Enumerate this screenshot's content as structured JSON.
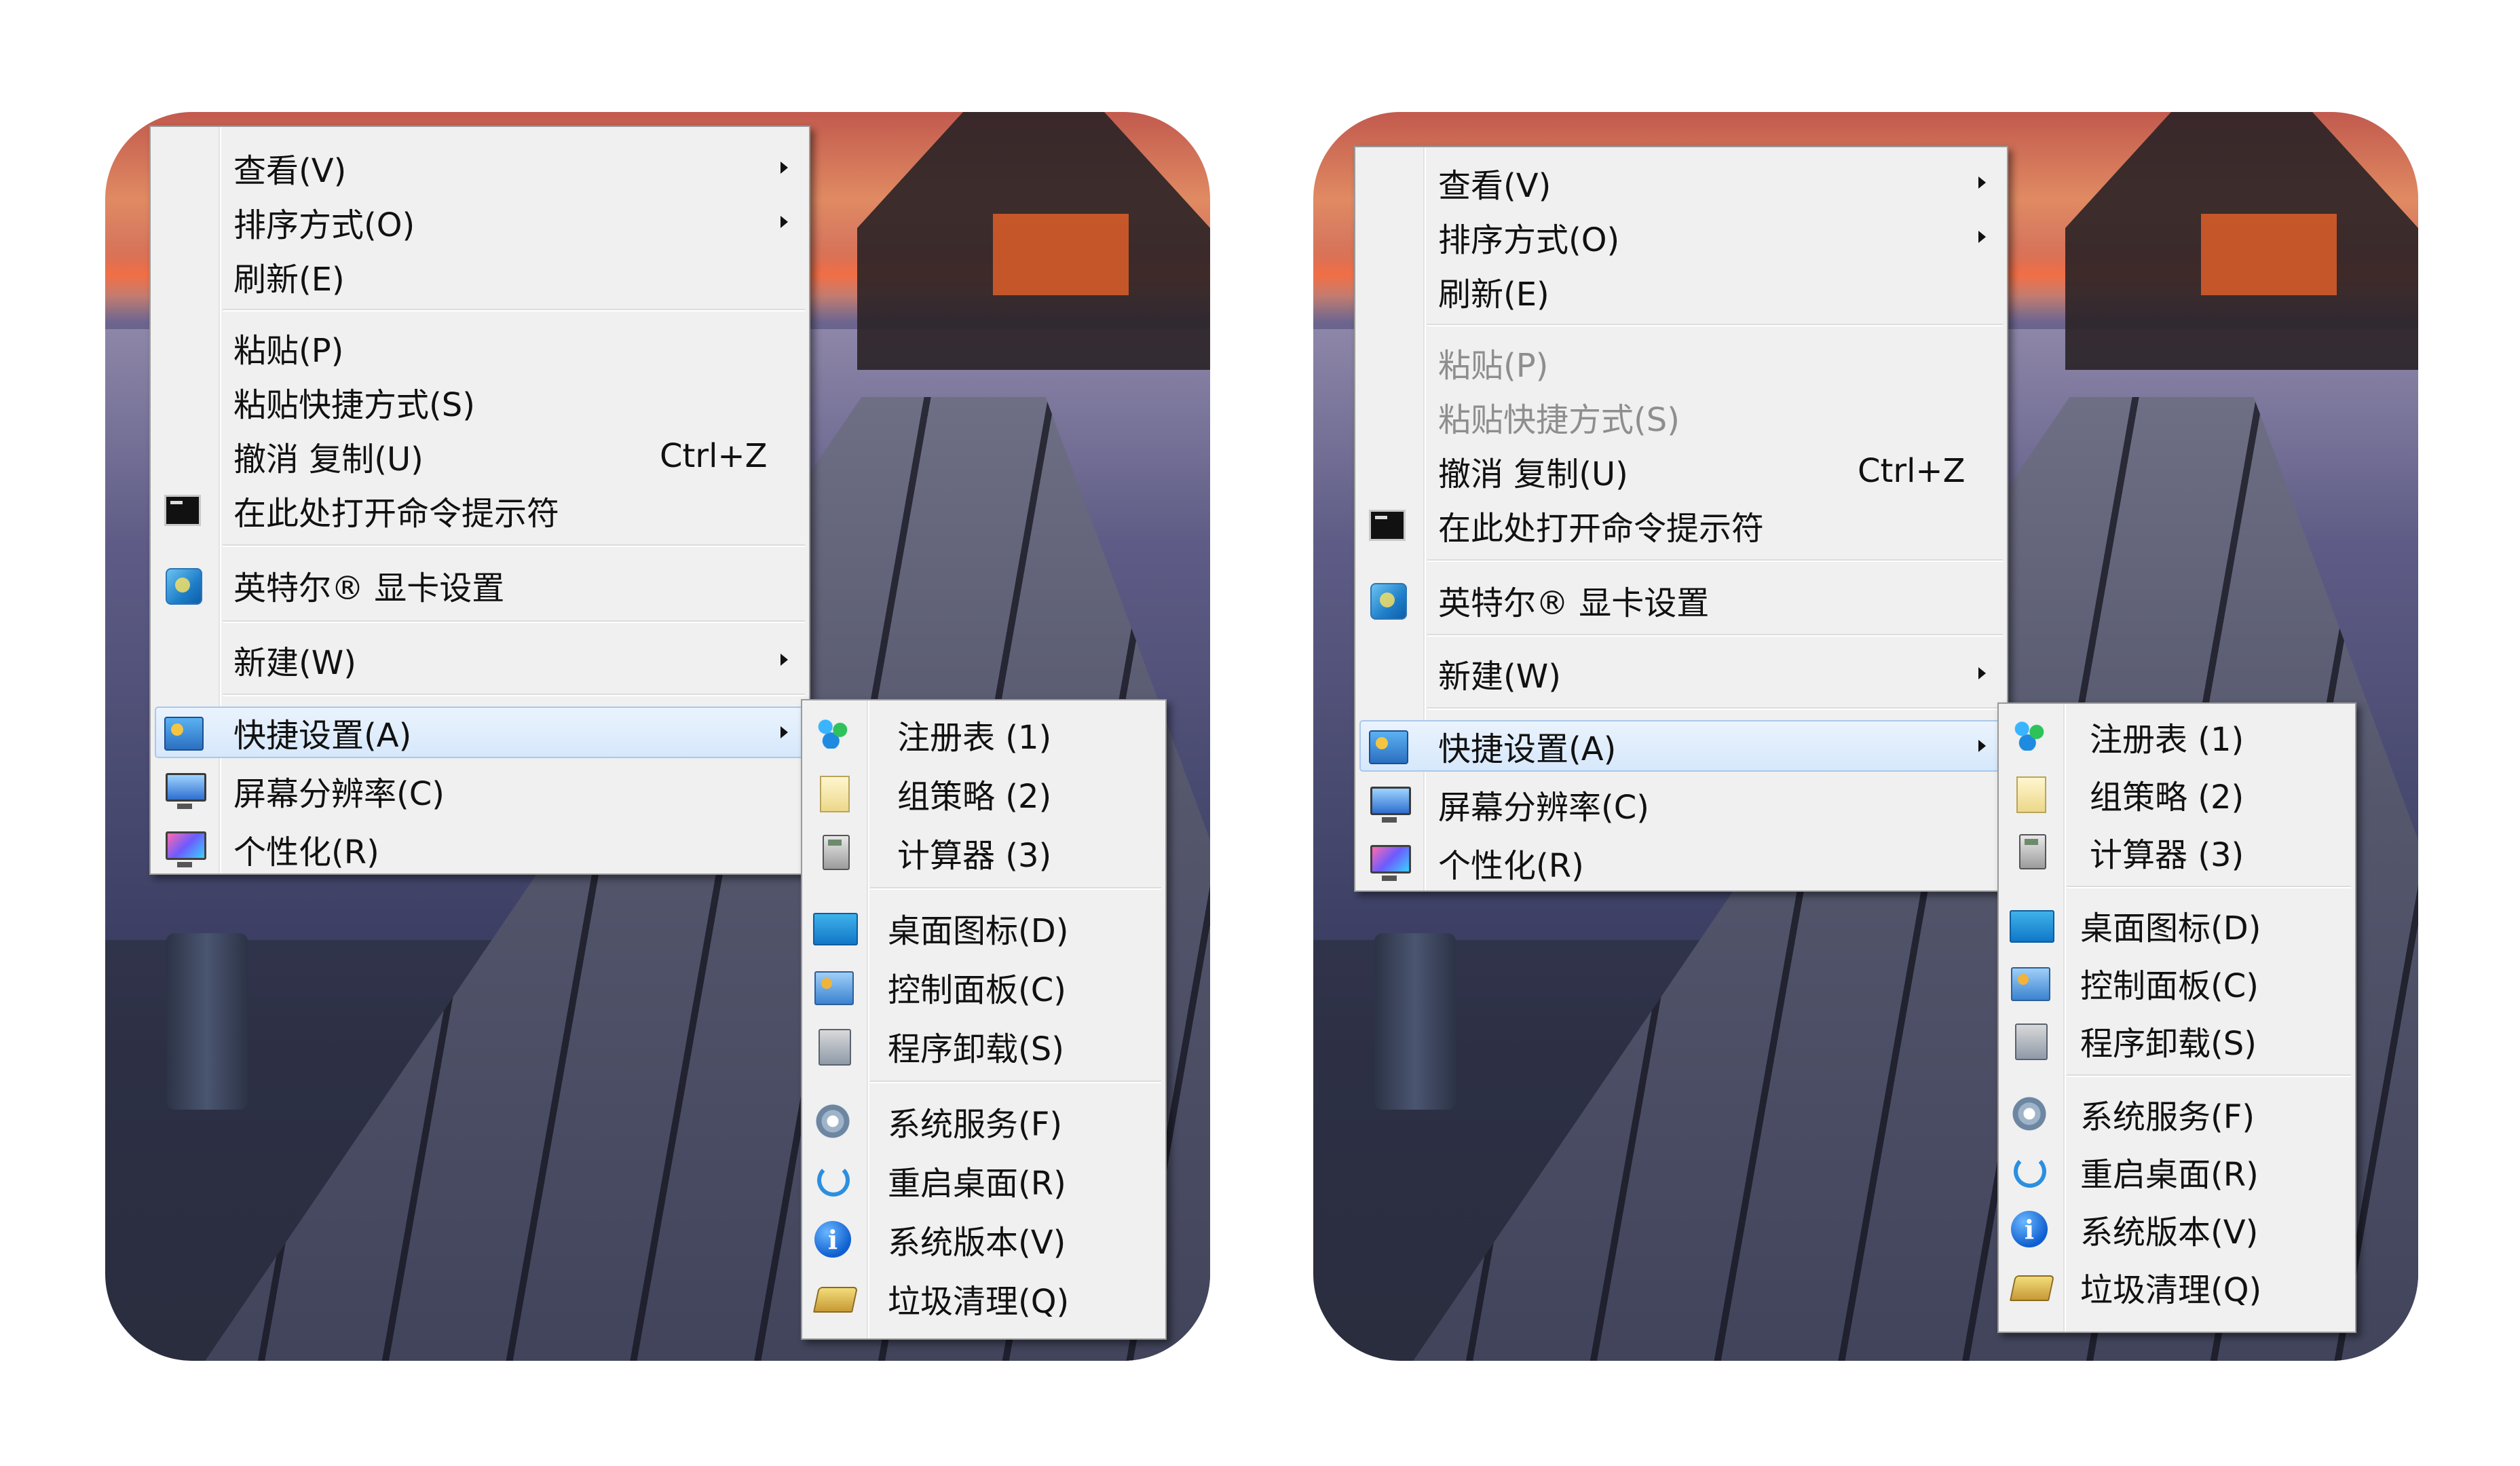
{
  "panels": [
    {
      "variant": "normal",
      "context_menu": {
        "items": [
          {
            "label": "查看(V)",
            "submenu": true
          },
          {
            "label": "排序方式(O)",
            "submenu": true
          },
          {
            "label": "刷新(E)"
          },
          {
            "label": "粘贴(P)"
          },
          {
            "label": "粘贴快捷方式(S)"
          },
          {
            "label": "撤消 复制(U)",
            "shortcut": "Ctrl+Z"
          },
          {
            "label": "在此处打开命令提示符",
            "icon": "cmd-icon"
          },
          {
            "label": "英特尔® 显卡设置",
            "icon": "intel-graphics-icon"
          },
          {
            "label": "新建(W)",
            "submenu": true
          },
          {
            "label": "快捷设置(A)",
            "submenu": true,
            "icon": "quick-settings-icon",
            "highlighted": true
          },
          {
            "label": "屏幕分辨率(C)",
            "icon": "monitor-icon"
          },
          {
            "label": "个性化(R)",
            "icon": "personalize-icon"
          }
        ]
      },
      "submenu": {
        "items": [
          {
            "label": "注册表  (1)",
            "icon": "registry-icon"
          },
          {
            "label": "组策略  (2)",
            "icon": "group-policy-icon"
          },
          {
            "label": "计算器  (3)",
            "icon": "calculator-icon"
          },
          {
            "label": "桌面图标(D)",
            "icon": "desktop-icon"
          },
          {
            "label": "控制面板(C)",
            "icon": "control-panel-icon"
          },
          {
            "label": "程序卸载(S)",
            "icon": "uninstall-icon"
          },
          {
            "label": "系统服务(F)",
            "icon": "services-icon"
          },
          {
            "label": "重启桌面(R)",
            "icon": "restart-icon"
          },
          {
            "label": "系统版本(V)",
            "icon": "info-icon"
          },
          {
            "label": "垃圾清理(Q)",
            "icon": "cleanup-icon"
          }
        ]
      }
    },
    {
      "variant": "paste-disabled",
      "context_menu": {
        "items": [
          {
            "label": "查看(V)",
            "submenu": true
          },
          {
            "label": "排序方式(O)",
            "submenu": true
          },
          {
            "label": "刷新(E)"
          },
          {
            "label": "粘贴(P)",
            "disabled": true
          },
          {
            "label": "粘贴快捷方式(S)",
            "disabled": true
          },
          {
            "label": "撤消 复制(U)",
            "shortcut": "Ctrl+Z"
          },
          {
            "label": "在此处打开命令提示符",
            "icon": "cmd-icon"
          },
          {
            "label": "英特尔® 显卡设置",
            "icon": "intel-graphics-icon"
          },
          {
            "label": "新建(W)",
            "submenu": true
          },
          {
            "label": "快捷设置(A)",
            "submenu": true,
            "icon": "quick-settings-icon",
            "highlighted": true
          },
          {
            "label": "屏幕分辨率(C)",
            "icon": "monitor-icon"
          },
          {
            "label": "个性化(R)",
            "icon": "personalize-icon"
          }
        ]
      },
      "submenu": {
        "items": [
          {
            "label": "注册表  (1)",
            "icon": "registry-icon"
          },
          {
            "label": "组策略  (2)",
            "icon": "group-policy-icon"
          },
          {
            "label": "计算器  (3)",
            "icon": "calculator-icon"
          },
          {
            "label": "桌面图标(D)",
            "icon": "desktop-icon"
          },
          {
            "label": "控制面板(C)",
            "icon": "control-panel-icon"
          },
          {
            "label": "程序卸载(S)",
            "icon": "uninstall-icon"
          },
          {
            "label": "系统服务(F)",
            "icon": "services-icon"
          },
          {
            "label": "重启桌面(R)",
            "icon": "restart-icon"
          },
          {
            "label": "系统版本(V)",
            "icon": "info-icon"
          },
          {
            "label": "垃圾清理(Q)",
            "icon": "cleanup-icon"
          }
        ]
      }
    }
  ]
}
